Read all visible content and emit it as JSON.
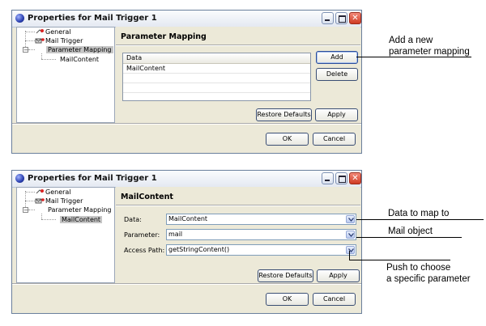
{
  "window1": {
    "title": "Properties for Mail Trigger 1",
    "tree": {
      "items": [
        {
          "label": "General"
        },
        {
          "label": "Mail Trigger"
        },
        {
          "label": "Parameter Mapping",
          "selected": true
        },
        {
          "label": "MailContent"
        }
      ]
    },
    "panel": {
      "title": "Parameter Mapping",
      "table": {
        "header": "Data",
        "rows": [
          "MailContent"
        ]
      },
      "add_label": "Add",
      "delete_label": "Delete",
      "restore_label": "Restore Defaults",
      "apply_label": "Apply"
    },
    "ok_label": "OK",
    "cancel_label": "Cancel"
  },
  "window2": {
    "title": "Properties for Mail Trigger 1",
    "tree": {
      "items": [
        {
          "label": "General"
        },
        {
          "label": "Mail Trigger"
        },
        {
          "label": "Parameter Mapping"
        },
        {
          "label": "MailContent",
          "selected": true
        }
      ]
    },
    "panel": {
      "title": "MailContent",
      "fields": [
        {
          "label": "Data:",
          "value": "MailContent"
        },
        {
          "label": "Parameter:",
          "value": "mail"
        },
        {
          "label": "Access Path:",
          "value": "getStringContent()"
        }
      ],
      "restore_label": "Restore Defaults",
      "apply_label": "Apply"
    },
    "ok_label": "OK",
    "cancel_label": "Cancel"
  },
  "annotations": {
    "add_note_line1": "Add a new",
    "add_note_line2": "parameter mapping",
    "data_note": "Data to map to",
    "mail_note": "Mail object",
    "push_note_line1": "Push to choose",
    "push_note_line2": "a specific parameter"
  },
  "colors": {
    "window_bg": "#ece9d8",
    "selection": "#c6c6c6",
    "close_button": "#cf3a22"
  }
}
